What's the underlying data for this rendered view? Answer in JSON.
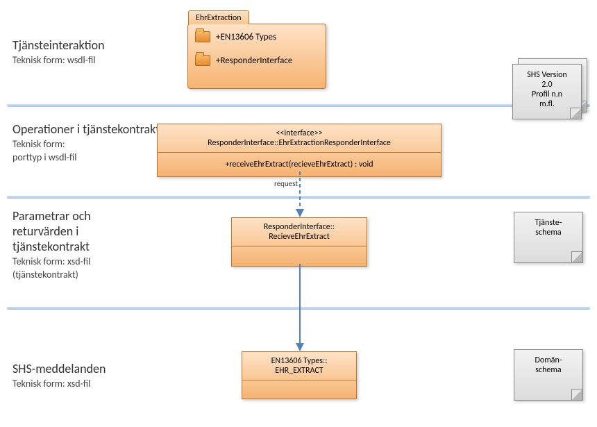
{
  "sections": {
    "s1": {
      "heading": "Tjänsteinteraktion",
      "sub": "Teknisk form: wsdl-fil"
    },
    "s2": {
      "heading": "Operationer i tjänstekontrakt",
      "sub": "Teknisk form:",
      "sub2": "porttyp i wsdl-fil"
    },
    "s3": {
      "heading": "Parametrar och returvärden i tjänstekontrakt",
      "sub": "Teknisk form: xsd-fil",
      "sub2": "(tjänstekontrakt)"
    },
    "s4": {
      "heading": "SHS-meddelanden",
      "sub": "Teknisk form: xsd-fil"
    }
  },
  "package": {
    "name": "EhrExtraction",
    "items": [
      "+EN13606 Types",
      "+ResponderInterface"
    ]
  },
  "interface_box": {
    "stereotype": "<<interface>>",
    "name": "ResponderInterface::EhrExtractionResponderInterface",
    "operation": "+receiveEhrExtract(recieveEhrExtract) : void"
  },
  "request_label": "request",
  "param_box": {
    "name_line1": "ResponderInterface::",
    "name_line2": "RecieveEhrExtract"
  },
  "message_box": {
    "name_line1": "EN13606 Types::",
    "name_line2": "EHR_EXTRACT"
  },
  "notes": {
    "shs": {
      "l1": "SHS Version",
      "l2": "2.0",
      "l3": "Profil n.n",
      "l4": "m.fl."
    },
    "tschema": {
      "l1": "Tjänste-",
      "l2": "schema"
    },
    "dschema": {
      "l1": "Domän-",
      "l2": "schema"
    }
  }
}
